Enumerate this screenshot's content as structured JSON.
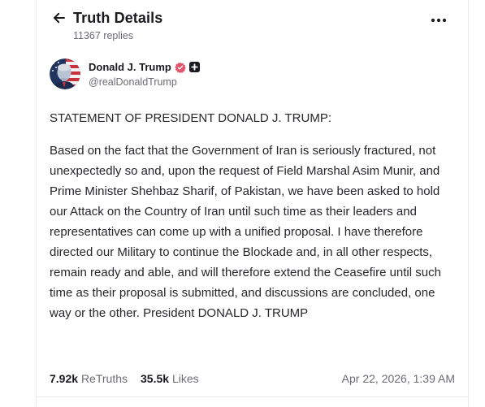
{
  "header": {
    "title": "Truth Details",
    "replies": "11367 replies",
    "back_icon": "arrow-left-icon",
    "more_icon": "more-horizontal-icon"
  },
  "author": {
    "name": "Donald J. Trump",
    "handle": "@realDonaldTrump",
    "verified": true,
    "verified_color": "#e3556b",
    "badge_icon": "plus-square-icon"
  },
  "post": {
    "paragraphs": [
      "STATEMENT OF PRESIDENT DONALD J. TRUMP:",
      "Based on the fact that the Government of Iran is seriously fractured, not unexpectedly so and, upon the request of Field Marshal Asim Munir, and Prime Minister Shehbaz Sharif, of Pakistan, we have been asked to hold our Attack on the Country of Iran until such time as their leaders and representatives can come up with a unified proposal. I have therefore directed our Military to continue the Blockade and, in all other respects, remain ready and able, and will therefore extend the Ceasefire until such time as their proposal is submitted, and discussions are concluded, one way or the other. President DONALD J. TRUMP"
    ]
  },
  "stats": {
    "retruths_count": "7.92k",
    "retruths_label": "ReTruths",
    "likes_count": "35.5k",
    "likes_label": "Likes",
    "timestamp": "Apr 22, 2026, 1:39 AM"
  },
  "colors": {
    "text": "#26262b",
    "muted": "#6b6b75",
    "border": "#ebebef"
  }
}
